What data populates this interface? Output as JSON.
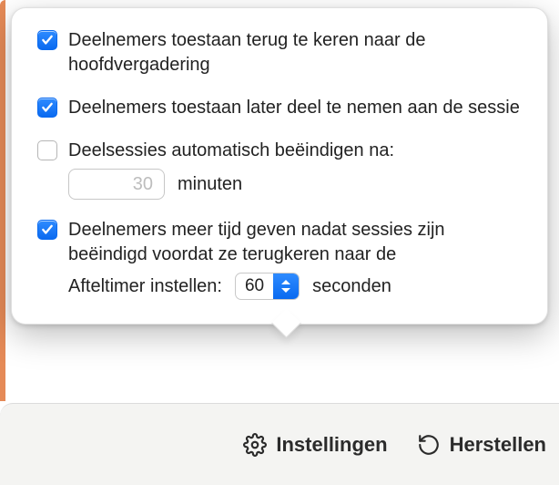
{
  "options": {
    "allow_return": {
      "checked": true,
      "label": "Deelnemers toestaan terug te keren naar de hoofdvergadering"
    },
    "allow_late_join": {
      "checked": true,
      "label": "Deelnemers toestaan later deel te nemen aan de sessie"
    },
    "auto_end": {
      "checked": false,
      "label": "Deelsessies automatisch beëindigen na:",
      "minutes_value": "30",
      "minutes_unit": "minuten"
    },
    "extra_time": {
      "checked": true,
      "label": "Deelnemers meer tijd geven nadat sessies zijn beëindigd voordat ze terugkeren naar de",
      "countdown_label": "Afteltimer instellen:",
      "countdown_value": "60",
      "countdown_unit": "seconden"
    }
  },
  "toolbar": {
    "settings_label": "Instellingen",
    "restore_label": "Herstellen"
  }
}
